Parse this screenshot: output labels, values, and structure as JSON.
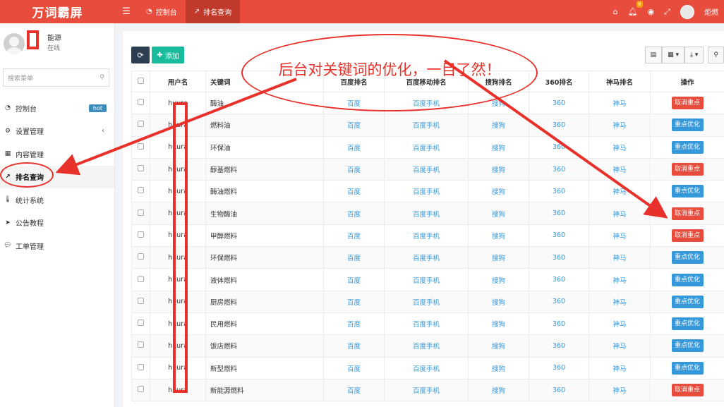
{
  "header": {
    "brand": "万词霸屏",
    "tabs": [
      {
        "label": "控制台",
        "icon": "dashboard-icon"
      },
      {
        "label": "排名查询",
        "icon": "line-chart-icon"
      }
    ],
    "notification_count": "8",
    "username": "炬燃"
  },
  "sidebar": {
    "user_name": "能源",
    "user_status": "在线",
    "search_placeholder": "搜索菜单",
    "items": [
      {
        "label": "控制台",
        "badge": "hot"
      },
      {
        "label": "设置管理"
      },
      {
        "label": "内容管理"
      },
      {
        "label": "排名查询"
      },
      {
        "label": "统计系统"
      },
      {
        "label": "公告教程"
      },
      {
        "label": "工单管理"
      }
    ]
  },
  "toolbar": {
    "add_label": "添加"
  },
  "table": {
    "headers": [
      "用户名",
      "关键词",
      "百度排名",
      "百度移动排名",
      "搜狗排名",
      "360排名",
      "神马排名",
      "操作"
    ],
    "rows": [
      {
        "user": "huura",
        "keyword": "酶油",
        "baidu": "百度",
        "baidu_mobile": "百度手机",
        "sogou": "搜狗",
        "s360": "360",
        "shenma": "神马",
        "action": "取消重点",
        "action_color": "red"
      },
      {
        "user": "huura",
        "keyword": "燃料油",
        "baidu": "百度",
        "baidu_mobile": "百度手机",
        "sogou": "搜狗",
        "s360": "360",
        "shenma": "神马",
        "action": "重点优化",
        "action_color": "blue"
      },
      {
        "user": "huura",
        "keyword": "环保油",
        "baidu": "百度",
        "baidu_mobile": "百度手机",
        "sogou": "搜狗",
        "s360": "360",
        "shenma": "神马",
        "action": "重点优化",
        "action_color": "blue"
      },
      {
        "user": "huura",
        "keyword": "醇基燃料",
        "baidu": "百度",
        "baidu_mobile": "百度手机",
        "sogou": "搜狗",
        "s360": "360",
        "shenma": "神马",
        "action": "取消重点",
        "action_color": "red"
      },
      {
        "user": "huura",
        "keyword": "酶油燃料",
        "baidu": "百度",
        "baidu_mobile": "百度手机",
        "sogou": "搜狗",
        "s360": "360",
        "shenma": "神马",
        "action": "重点优化",
        "action_color": "blue"
      },
      {
        "user": "huura",
        "keyword": "生物酶油",
        "baidu": "百度",
        "baidu_mobile": "百度手机",
        "sogou": "搜狗",
        "s360": "360",
        "shenma": "神马",
        "action": "取消重点",
        "action_color": "red"
      },
      {
        "user": "huura",
        "keyword": "甲醇燃料",
        "baidu": "百度",
        "baidu_mobile": "百度手机",
        "sogou": "搜狗",
        "s360": "360",
        "shenma": "神马",
        "action": "取消重点",
        "action_color": "red"
      },
      {
        "user": "huura",
        "keyword": "环保燃料",
        "baidu": "百度",
        "baidu_mobile": "百度手机",
        "sogou": "搜狗",
        "s360": "360",
        "shenma": "神马",
        "action": "重点优化",
        "action_color": "blue"
      },
      {
        "user": "huura",
        "keyword": "液体燃料",
        "baidu": "百度",
        "baidu_mobile": "百度手机",
        "sogou": "搜狗",
        "s360": "360",
        "shenma": "神马",
        "action": "重点优化",
        "action_color": "blue"
      },
      {
        "user": "huura",
        "keyword": "厨房燃料",
        "baidu": "百度",
        "baidu_mobile": "百度手机",
        "sogou": "搜狗",
        "s360": "360",
        "shenma": "神马",
        "action": "重点优化",
        "action_color": "blue"
      },
      {
        "user": "huura",
        "keyword": "民用燃料",
        "baidu": "百度",
        "baidu_mobile": "百度手机",
        "sogou": "搜狗",
        "s360": "360",
        "shenma": "神马",
        "action": "重点优化",
        "action_color": "blue"
      },
      {
        "user": "huura",
        "keyword": "饭店燃料",
        "baidu": "百度",
        "baidu_mobile": "百度手机",
        "sogou": "搜狗",
        "s360": "360",
        "shenma": "神马",
        "action": "重点优化",
        "action_color": "blue"
      },
      {
        "user": "huura",
        "keyword": "新型燃料",
        "baidu": "百度",
        "baidu_mobile": "百度手机",
        "sogou": "搜狗",
        "s360": "360",
        "shenma": "神马",
        "action": "重点优化",
        "action_color": "blue"
      },
      {
        "user": "huura",
        "keyword": "新能源燃料",
        "baidu": "百度",
        "baidu_mobile": "百度手机",
        "sogou": "搜狗",
        "s360": "360",
        "shenma": "神马",
        "action": "取消重点",
        "action_color": "red"
      }
    ]
  },
  "annotation": {
    "bubble_text": "后台对关键词的优化，一目了然！",
    "color": "#e8312a"
  }
}
